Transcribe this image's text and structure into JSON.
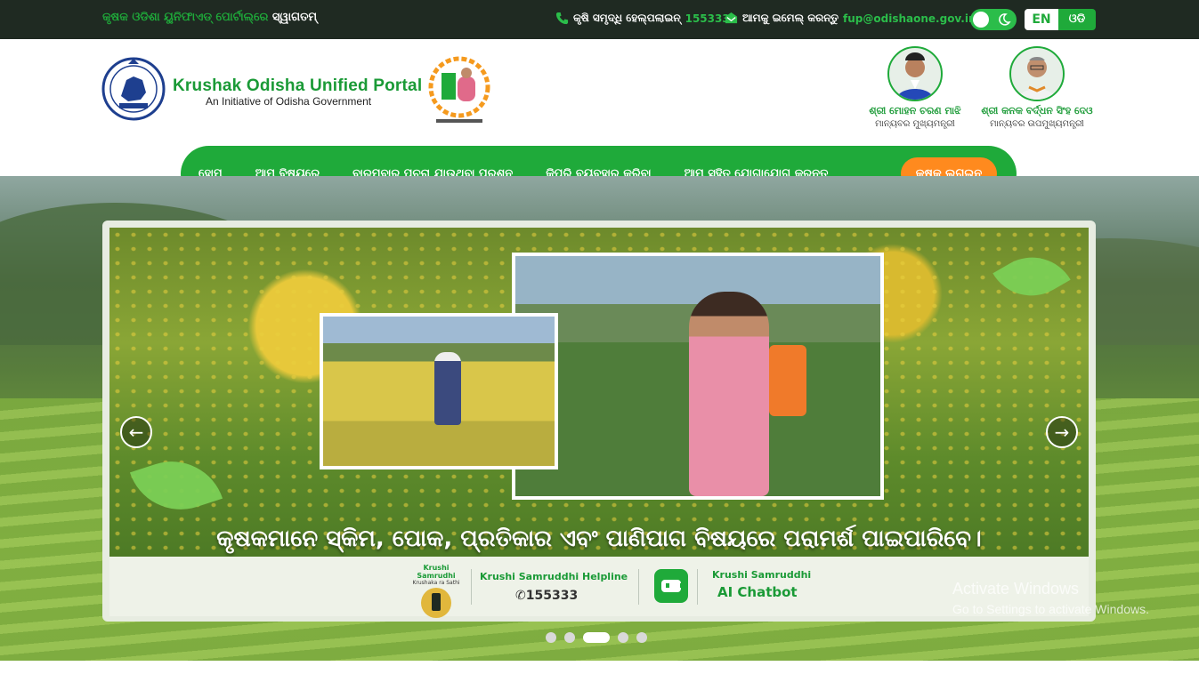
{
  "topbar": {
    "welcome_prefix": "କୃଷକ ଓଡିଶା ୟୁନିଫାଏଡ୍ ପୋର୍ଟାଲ୍‌ରେ ",
    "welcome_highlight": "ସ୍ୱାଗତମ୍",
    "helpline_label": "କୃଷି ସମୃଦ୍ଧି ହେଲ୍ପଲାଇନ୍",
    "helpline_number": "155333",
    "email_label": "ଆମକୁ ଇମେଲ୍ କରନ୍ତୁ",
    "email": "fup@odishaone.gov.in",
    "lang_en": "EN",
    "lang_od": "ଓଡି"
  },
  "header": {
    "title": "Krushak Odisha Unified Portal",
    "subtitle": "An Initiative of Odisha Government",
    "leaders": [
      {
        "name": "ଶ୍ରୀ ମୋହନ ଚରଣ ମାଝି",
        "designation": "ମାନ୍ୟବର ମୁଖ୍ୟମନ୍ତ୍ରୀ"
      },
      {
        "name": "ଶ୍ରୀ କନକ ବର୍ଦ୍ଧନ ସିଂହ ଦେଓ",
        "designation": "ମାନ୍ୟବର ଉପମୁଖ୍ୟମନ୍ତ୍ରୀ"
      }
    ]
  },
  "nav": {
    "items": [
      "ହୋମ୍",
      "ଆମ ବିଷୟରେ",
      "ବାରମ୍ବାର ପଚରା ଯାଉଥିବା ପ୍ରଶ୍ନ",
      "କିପରି ବ୍ୟବହାର କରିବା",
      "ଆମ ସହିତ ଯୋଗାଯୋଗ କରନ୍ତୁ"
    ],
    "login": "କୃଷକ ଲଗଇନ୍"
  },
  "hero": {
    "caption": "କୃଷକମାନେ ସ୍କିମ, ପୋକ, ପ୍ରତିକାର ଏବଂ ପାଣିପାଗ ବିଷୟରେ ପରାମର୍ଶ ପାଇପାରିବେ।",
    "ks_logo_title": "Krushi Samrudhi",
    "ks_logo_sub": "Krushaka ra Sathi",
    "helpline_title": "Krushi Samruddhi Helpline",
    "helpline_phone": "155333",
    "chatbot_title": "Krushi Samruddhi",
    "chatbot_sub": "AI Chatbot",
    "prev_arrow": "←",
    "next_arrow": "→"
  },
  "colors": {
    "brand_green": "#1faa3a",
    "accent_orange": "#ff8a1e",
    "topbar_bg": "#1f2a22"
  },
  "watermark": {
    "line1": "Activate Windows",
    "line2": "Go to Settings to activate Windows."
  }
}
